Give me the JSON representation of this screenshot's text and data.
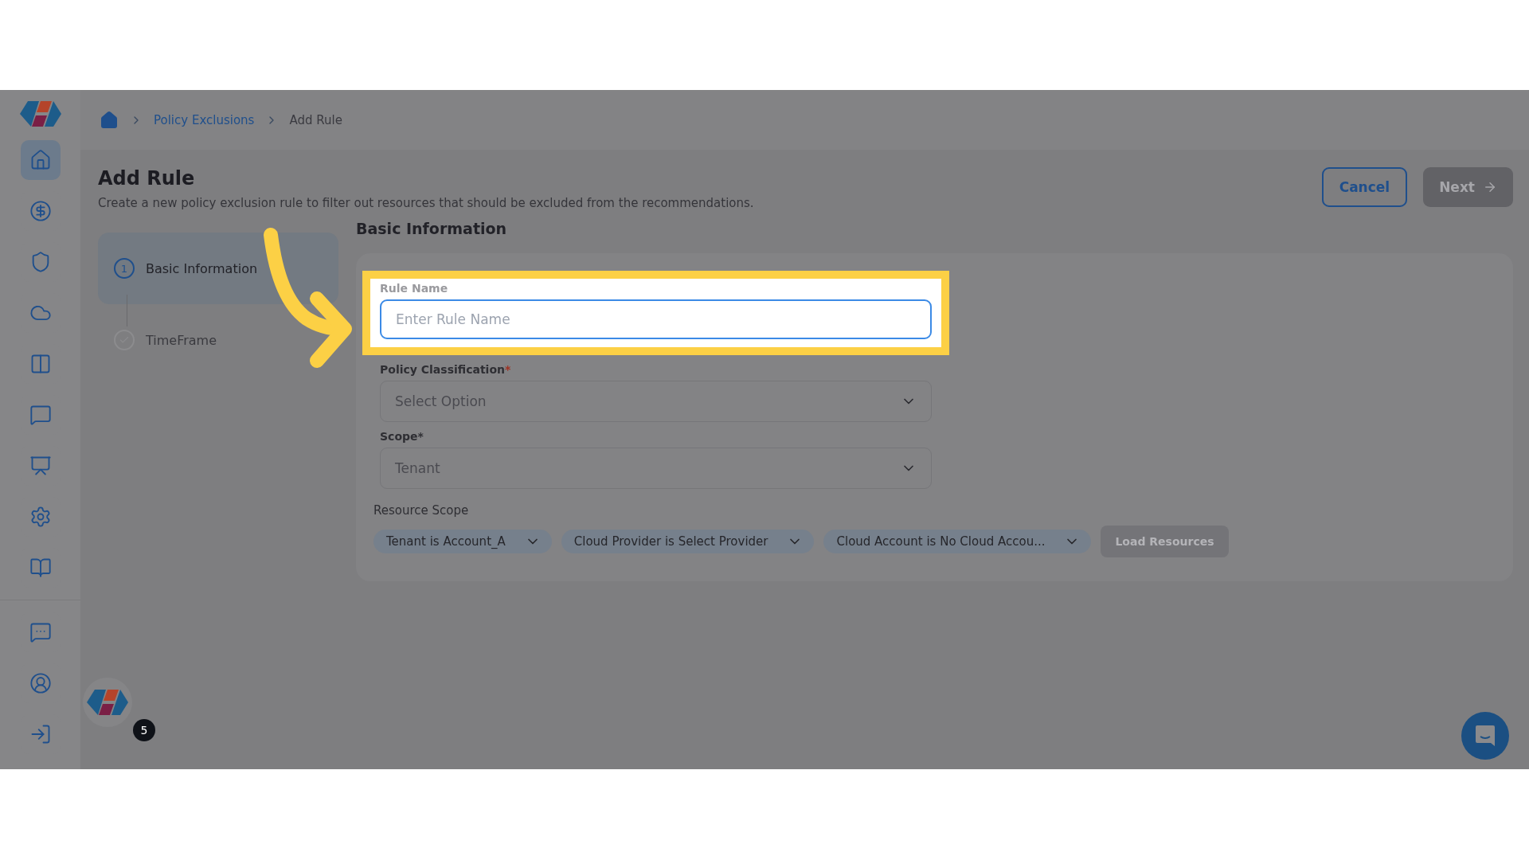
{
  "sidebar": {
    "items": [
      {
        "selected": true
      },
      {
        "selected": false
      },
      {
        "selected": false
      },
      {
        "selected": false
      },
      {
        "selected": false
      },
      {
        "selected": false
      },
      {
        "selected": false
      },
      {
        "selected": false
      },
      {
        "selected": false
      }
    ],
    "bottom_items": [
      {
        "selected": false
      },
      {
        "selected": false
      },
      {
        "selected": false
      }
    ]
  },
  "breadcrumb": [
    {
      "label": "Policy Exclusions",
      "kind": "link"
    },
    {
      "label": "Add Rule",
      "kind": "current"
    }
  ],
  "page": {
    "title": "Add Rule",
    "description": "Create a new policy exclusion rule to filter out resources that should be excluded from the recommendations."
  },
  "actions": [
    {
      "label": "Cancel",
      "kind": "outline",
      "disabled": false
    },
    {
      "label": "Next",
      "kind": "primary",
      "disabled": true
    }
  ],
  "steps": [
    {
      "kind": "number",
      "number": "1",
      "label": "Basic Information",
      "selected": true
    },
    {
      "kind": "check",
      "label": "TimeFrame",
      "selected": false
    }
  ],
  "section": {
    "title": "Basic Information"
  },
  "fields": [
    {
      "kind": "text",
      "label": "Rule Name",
      "placeholder": "Enter Rule Name",
      "highlighted": true
    },
    {
      "kind": "select",
      "label": "Policy Classification",
      "required_mark": "*",
      "value": "Select Option",
      "highlighted": false
    },
    {
      "kind": "select",
      "label": "Scope*",
      "value": "Tenant",
      "highlighted": false
    }
  ],
  "resource_scope": {
    "label": "Resource Scope",
    "filters": [
      "Tenant is Account_A",
      "Cloud Provider is Select Provider",
      "Cloud Account is No Cloud Accou..."
    ],
    "load_button": {
      "label": "Load Resources",
      "disabled": true
    }
  },
  "assistant": {
    "badge": "5"
  }
}
